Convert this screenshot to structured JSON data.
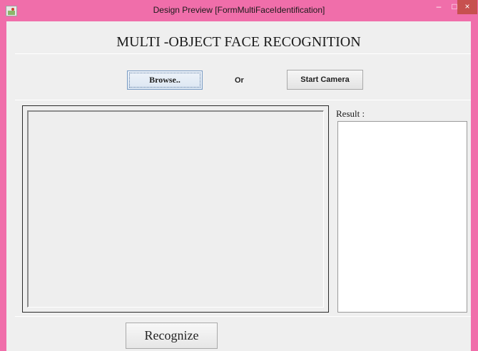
{
  "window": {
    "title": "Design Preview [FormMultiFaceIdentification]",
    "minimize_glyph": "–",
    "maximize_glyph": "□",
    "close_glyph": "×",
    "accent_color": "#f06eaa",
    "close_color": "#c7504f"
  },
  "header": {
    "title": "MULTI -OBJECT FACE RECOGNITION"
  },
  "controls": {
    "browse_label": "Browse..",
    "or_label": "Or",
    "camera_label": "Start Camera"
  },
  "result": {
    "label": "Result :",
    "value": ""
  },
  "footer": {
    "recognize_label": "Recognize"
  },
  "icons": {
    "app": "java-app-icon"
  }
}
